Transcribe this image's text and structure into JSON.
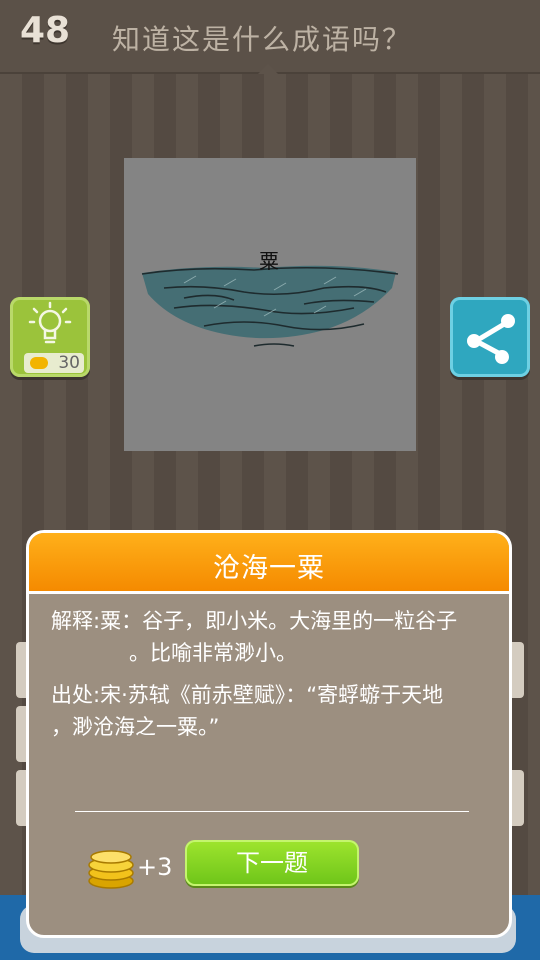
{
  "header": {
    "level": "48",
    "question": "知道这是什么成语吗？"
  },
  "puzzle": {
    "glyph": "粟"
  },
  "hint": {
    "cost": "30"
  },
  "answer": {
    "title": "沧海一粟",
    "explanation_line1": "解释:粟：谷子，即小米。大海里的一粒谷子",
    "explanation_line2": "。比喻非常渺小。",
    "source_line1": "出处:宋·苏轼《前赤壁赋》：“寄蜉蝣于天地",
    "source_line2": "，渺沧海之一粟。”",
    "reward": "+3",
    "next_label": "下一题"
  },
  "colors": {
    "accent": "#f58a00",
    "next": "#7bd11f",
    "share": "#2fa7bf",
    "hint": "#9bc33b"
  },
  "icons": [
    "lightbulb-icon",
    "coin-icon",
    "share-icon",
    "coin-stack-icon"
  ]
}
